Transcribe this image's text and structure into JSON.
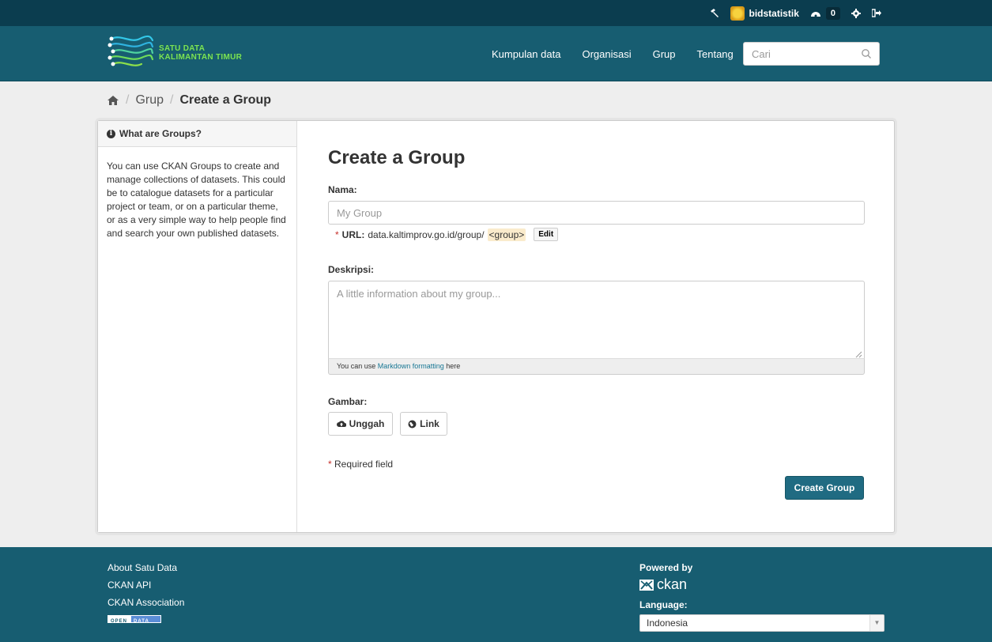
{
  "account": {
    "username": "bidstatistik",
    "dashboard_count": "0"
  },
  "logo": {
    "line1": "SATU DATA",
    "line2": "KALIMANTAN TIMUR"
  },
  "nav": {
    "items": [
      "Kumpulan data",
      "Organisasi",
      "Grup",
      "Tentang"
    ],
    "search_placeholder": "Cari"
  },
  "breadcrumb": {
    "items": [
      "Grup",
      "Create a Group"
    ]
  },
  "sidebar": {
    "title": "What are Groups?",
    "body": "You can use CKAN Groups to create and manage collections of datasets. This could be to catalogue datasets for a particular project or team, or on a particular theme, or as a very simple way to help people find and search your own published datasets."
  },
  "form": {
    "title": "Create a Group",
    "name_label": "Nama:",
    "name_placeholder": "My Group",
    "url_label": "URL:",
    "url_prefix": "data.kaltimprov.go.id/group/",
    "url_slug": "<group>",
    "edit_label": "Edit",
    "description_label": "Deskripsi:",
    "description_placeholder": "A little information about my group...",
    "markdown_hint_pre": "You can use ",
    "markdown_link": "Markdown formatting",
    "markdown_hint_post": " here",
    "image_label": "Gambar:",
    "upload_label": "Unggah",
    "link_label": "Link",
    "required_note": "Required field",
    "submit_label": "Create Group"
  },
  "footer": {
    "links": [
      "About Satu Data",
      "CKAN API",
      "CKAN Association"
    ],
    "open_data_left": "OPEN",
    "open_data_right": "DATA",
    "powered_by": "Powered by",
    "ckan_text": "ckan",
    "language_label": "Language:",
    "language_value": "Indonesia"
  },
  "colors": {
    "header_bg": "#175d71",
    "account_bar_bg": "#0b3d4f",
    "primary_button": "#206b82"
  }
}
